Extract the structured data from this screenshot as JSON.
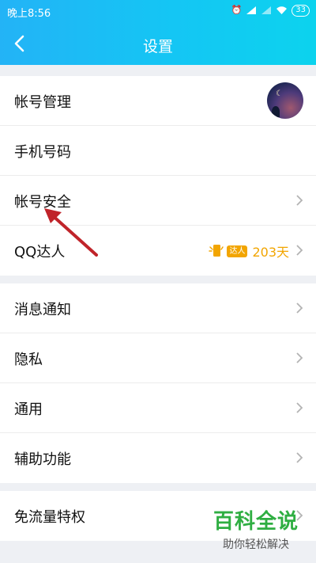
{
  "status_bar": {
    "time": "晚上8:56",
    "battery": "33",
    "icons": [
      "alarm-icon",
      "signal-icon",
      "signal-icon",
      "wifi-icon",
      "battery-icon"
    ]
  },
  "nav": {
    "title": "设置",
    "back_icon": "chevron-left-icon"
  },
  "groups": [
    {
      "items": [
        {
          "label": "帐号管理",
          "trailing": "avatar"
        },
        {
          "label": "手机号码"
        },
        {
          "label": "帐号安全",
          "trailing": "chevron-right-icon"
        },
        {
          "label": "QQ达人",
          "badge": {
            "tag": "达人",
            "days": "203天"
          },
          "trailing": "chevron-right-icon"
        }
      ]
    },
    {
      "items": [
        {
          "label": "消息通知",
          "trailing": "chevron-right-icon"
        },
        {
          "label": "隐私",
          "trailing": "chevron-right-icon"
        },
        {
          "label": "通用",
          "trailing": "chevron-right-icon"
        },
        {
          "label": "辅助功能",
          "trailing": "chevron-right-icon"
        }
      ]
    },
    {
      "items": [
        {
          "label": "免流量特权",
          "trailing": "chevron-right-icon"
        }
      ]
    }
  ],
  "watermark": {
    "brand": "百科全说",
    "slogan": "助你轻松解决"
  },
  "colors": {
    "header_start": "#23b3f6",
    "header_end": "#0cd3ee",
    "badge": "#f2a500",
    "annotation_arrow": "#c0242a",
    "watermark": "#2fae42"
  }
}
